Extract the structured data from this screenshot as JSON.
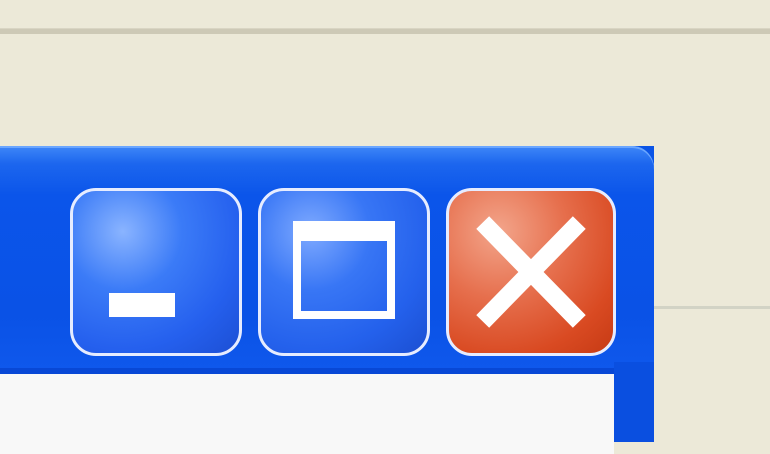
{
  "window": {
    "title_bar_color": "#0A54E6",
    "content_color": "#F8F8F8"
  },
  "caption_buttons": [
    {
      "action": "minimize",
      "icon": "minimize-icon",
      "color": "#2560EE"
    },
    {
      "action": "maximize",
      "icon": "maximize-icon",
      "color": "#2461EC"
    },
    {
      "action": "close",
      "icon": "close-icon",
      "color": "#D94A22"
    }
  ],
  "desktop": {
    "background_color": "#ECE9D8"
  }
}
